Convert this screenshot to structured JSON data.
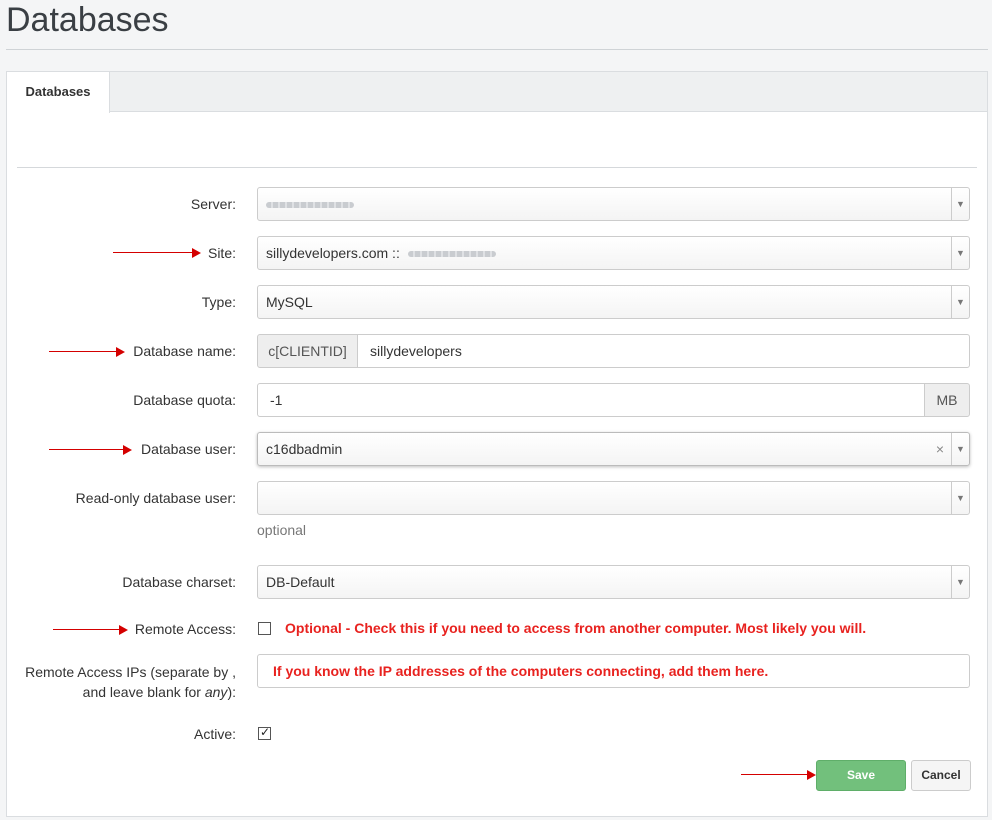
{
  "page": {
    "title": "Databases"
  },
  "tabs": [
    {
      "label": "Databases",
      "active": true
    }
  ],
  "form": {
    "server": {
      "label": "Server:"
    },
    "site": {
      "label": "Site:",
      "value": "sillydevelopers.com ::"
    },
    "type": {
      "label": "Type:",
      "value": "MySQL"
    },
    "database_name": {
      "label": "Database name:",
      "prefix": "c[CLIENTID]",
      "value": "sillydevelopers"
    },
    "database_quota": {
      "label": "Database quota:",
      "value": "-1",
      "unit": "MB"
    },
    "database_user": {
      "label": "Database user:",
      "value": "c16dbadmin",
      "clear": "×"
    },
    "readonly_user": {
      "label": "Read-only database user:",
      "value": "",
      "hint": "optional"
    },
    "charset": {
      "label": "Database charset:",
      "value": "DB-Default"
    },
    "remote_access": {
      "label": "Remote Access:",
      "checked": false,
      "note": "Optional - Check this if you need to access from another computer.  Most likely you will."
    },
    "remote_ips": {
      "label_part1": "Remote Access IPs (separate by ,",
      "label_part2": "and leave blank for ",
      "label_em": "any",
      "label_part3": "):",
      "note": "If you know the IP addresses of the computers connecting, add them here."
    },
    "active": {
      "label": "Active:",
      "checked": true,
      "tick": "✓"
    }
  },
  "caret": "▼",
  "buttons": {
    "save": "Save",
    "cancel": "Cancel"
  },
  "colors": {
    "annotation_red": "#e8221f",
    "save_green": "#72c07c"
  }
}
